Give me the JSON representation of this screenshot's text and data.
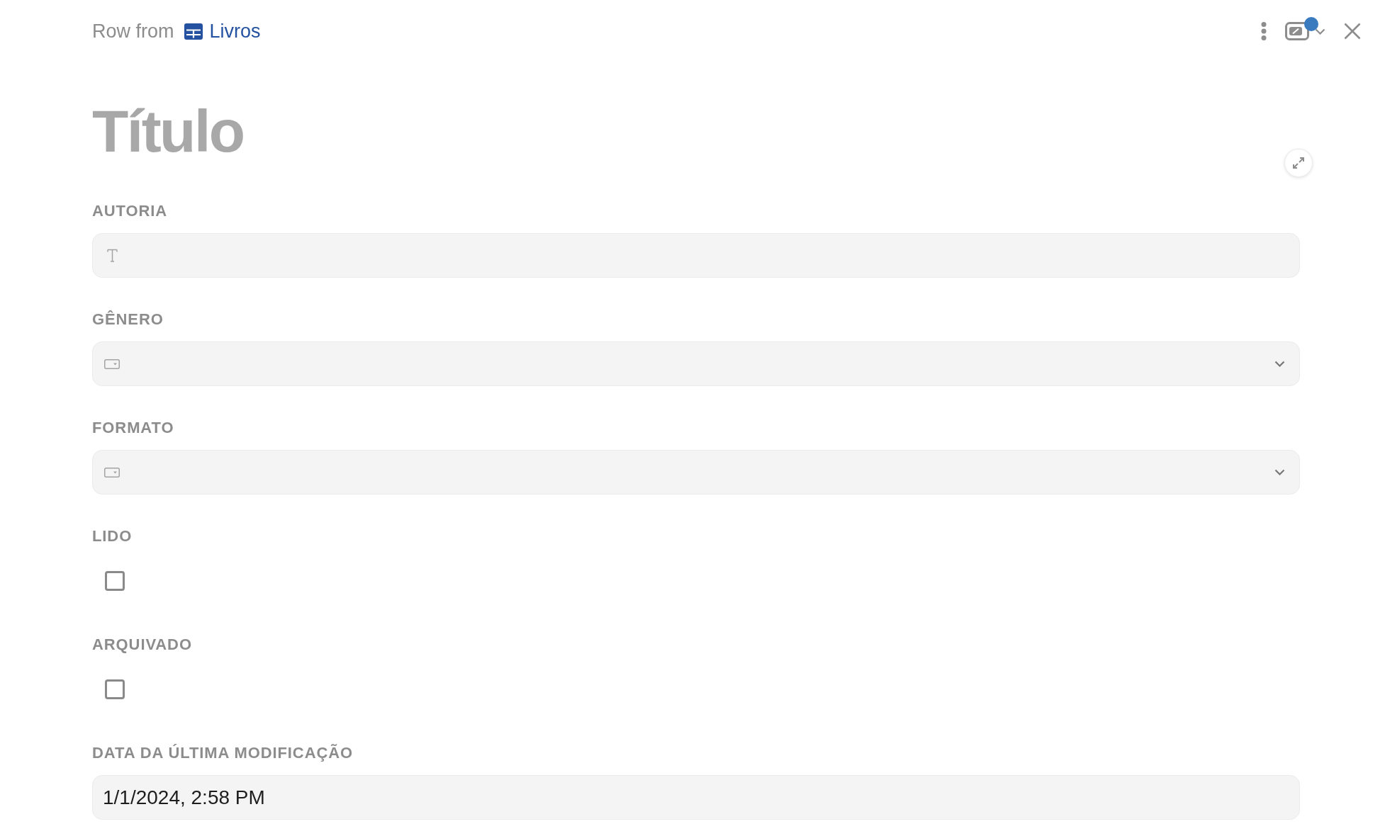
{
  "header": {
    "prefix": "Row from",
    "table_link": "Livros"
  },
  "toolbar": {
    "view_menu": {
      "notification": true
    }
  },
  "title": {
    "placeholder": "Título"
  },
  "fields": [
    {
      "label": "AUTORIA",
      "kind": "text"
    },
    {
      "label": "GÊNERO",
      "kind": "select"
    },
    {
      "label": "FORMATO",
      "kind": "select"
    },
    {
      "label": "LIDO",
      "kind": "checkbox",
      "checked": false
    },
    {
      "label": "ARQUIVADO",
      "kind": "checkbox",
      "checked": false
    },
    {
      "label": "DATA DA ÚLTIMA MODIFICAÇÃO",
      "kind": "datetime",
      "value": "1/1/2024, 2:58 PM"
    }
  ]
}
